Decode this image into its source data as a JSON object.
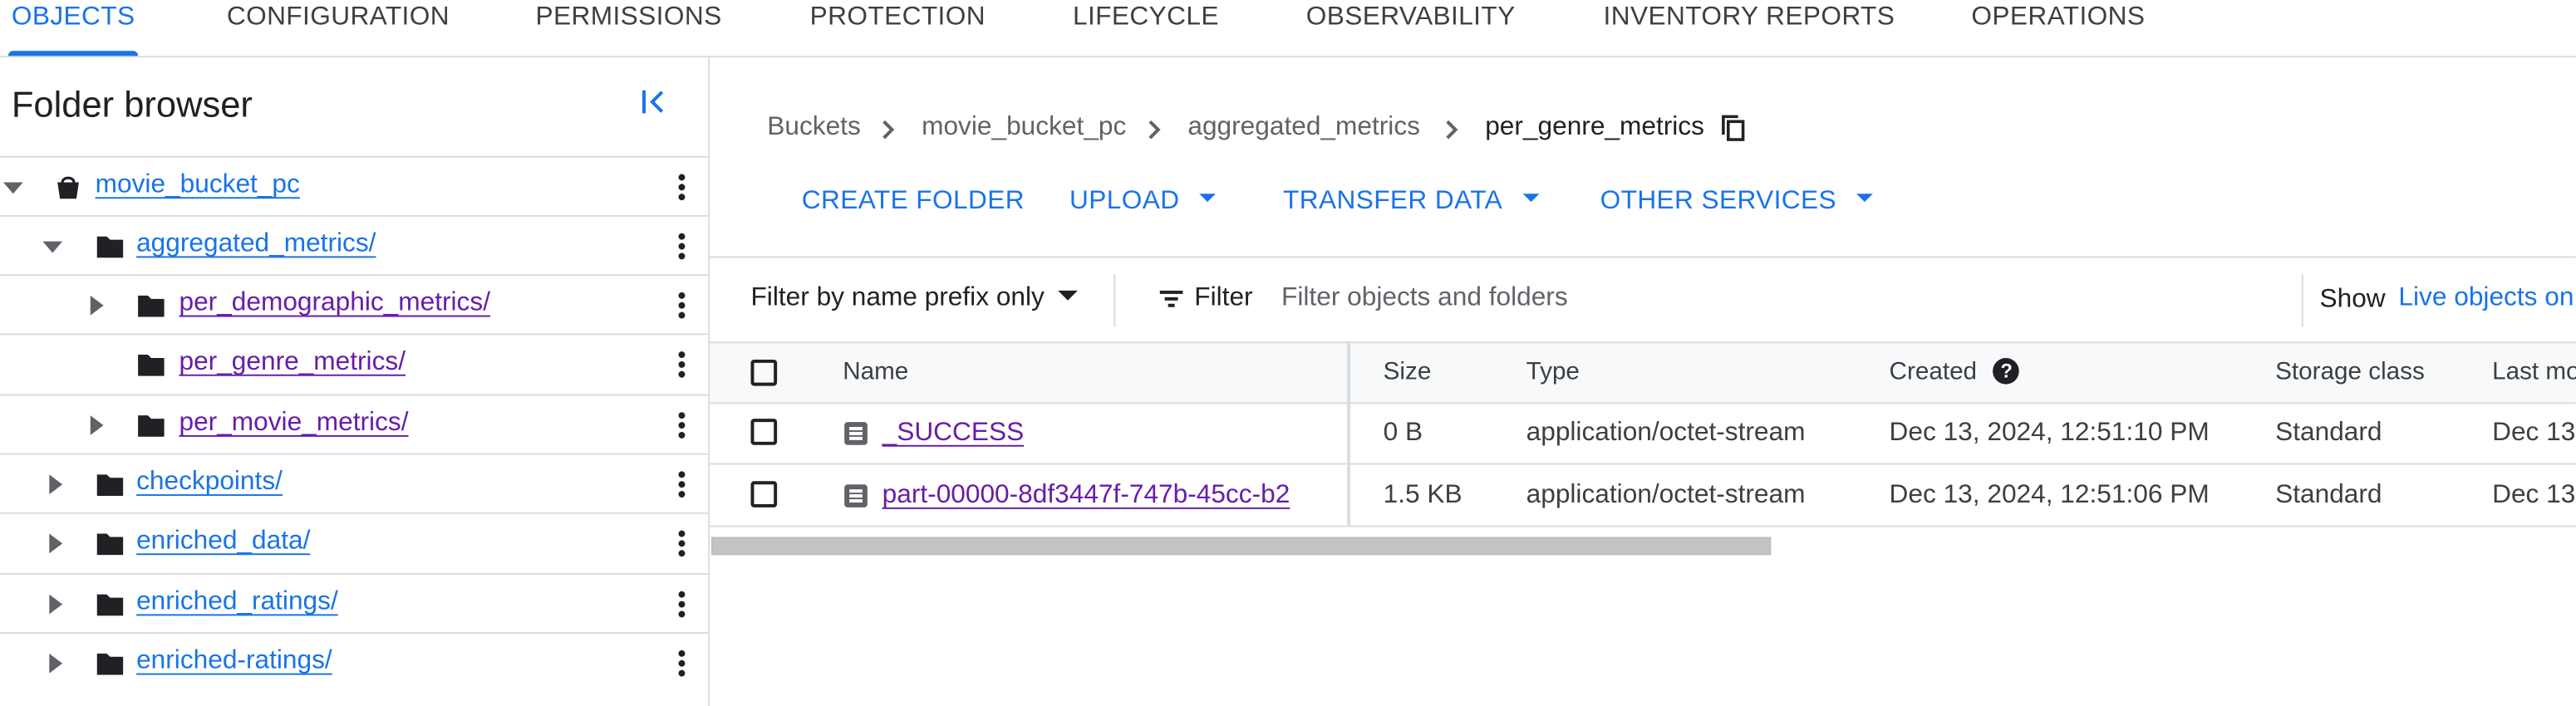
{
  "tabs": [
    {
      "label": "OBJECTS",
      "active": true
    },
    {
      "label": "CONFIGURATION"
    },
    {
      "label": "PERMISSIONS"
    },
    {
      "label": "PROTECTION"
    },
    {
      "label": "LIFECYCLE"
    },
    {
      "label": "OBSERVABILITY"
    },
    {
      "label": "INVENTORY REPORTS"
    },
    {
      "label": "OPERATIONS"
    }
  ],
  "sidebar": {
    "title": "Folder browser",
    "collapse_icon": "collapse-left-icon",
    "items": [
      {
        "label": "movie_bucket_pc",
        "icon": "bucket-icon",
        "expanded": true
      },
      {
        "label": "aggregated_metrics/",
        "icon": "folder-icon",
        "expanded": true
      },
      {
        "label": "per_demographic_metrics/",
        "icon": "folder-icon",
        "expanded": false
      },
      {
        "label": "per_genre_metrics/",
        "icon": "folder-icon"
      },
      {
        "label": "per_movie_metrics/",
        "icon": "folder-icon",
        "expanded": false
      },
      {
        "label": "checkpoints/",
        "icon": "folder-icon",
        "expanded": false
      },
      {
        "label": "enriched_data/",
        "icon": "folder-icon",
        "expanded": false
      },
      {
        "label": "enriched_ratings/",
        "icon": "folder-icon",
        "expanded": false
      },
      {
        "label": "enriched-ratings/",
        "icon": "folder-icon",
        "expanded": false
      }
    ]
  },
  "breadcrumbs": [
    "Buckets",
    "movie_bucket_pc",
    "aggregated_metrics",
    "per_genre_metrics"
  ],
  "actions": {
    "create_folder": "CREATE FOLDER",
    "upload": "UPLOAD",
    "transfer_data": "TRANSFER DATA",
    "other_services": "OTHER SERVICES"
  },
  "filter": {
    "mode": "Filter by name prefix only",
    "label": "Filter",
    "placeholder": "Filter objects and folders",
    "show_label": "Show",
    "show_value": "Live objects on"
  },
  "table": {
    "columns": [
      "Name",
      "Size",
      "Type",
      "Created",
      "Storage class",
      "Last mo"
    ],
    "rows": [
      {
        "name": "_SUCCESS",
        "size": "0 B",
        "type": "application/octet-stream",
        "created": "Dec 13, 2024, 12:51:10 PM",
        "storage": "Standard",
        "last": "Dec 13"
      },
      {
        "name": "part-00000-8df3447f-747b-45cc-b2",
        "size": "1.5 KB",
        "type": "application/octet-stream",
        "created": "Dec 13, 2024, 12:51:06 PM",
        "storage": "Standard",
        "last": "Dec 13"
      }
    ]
  },
  "colors": {
    "accent": "#1a73e8",
    "visited": "#681da8"
  }
}
